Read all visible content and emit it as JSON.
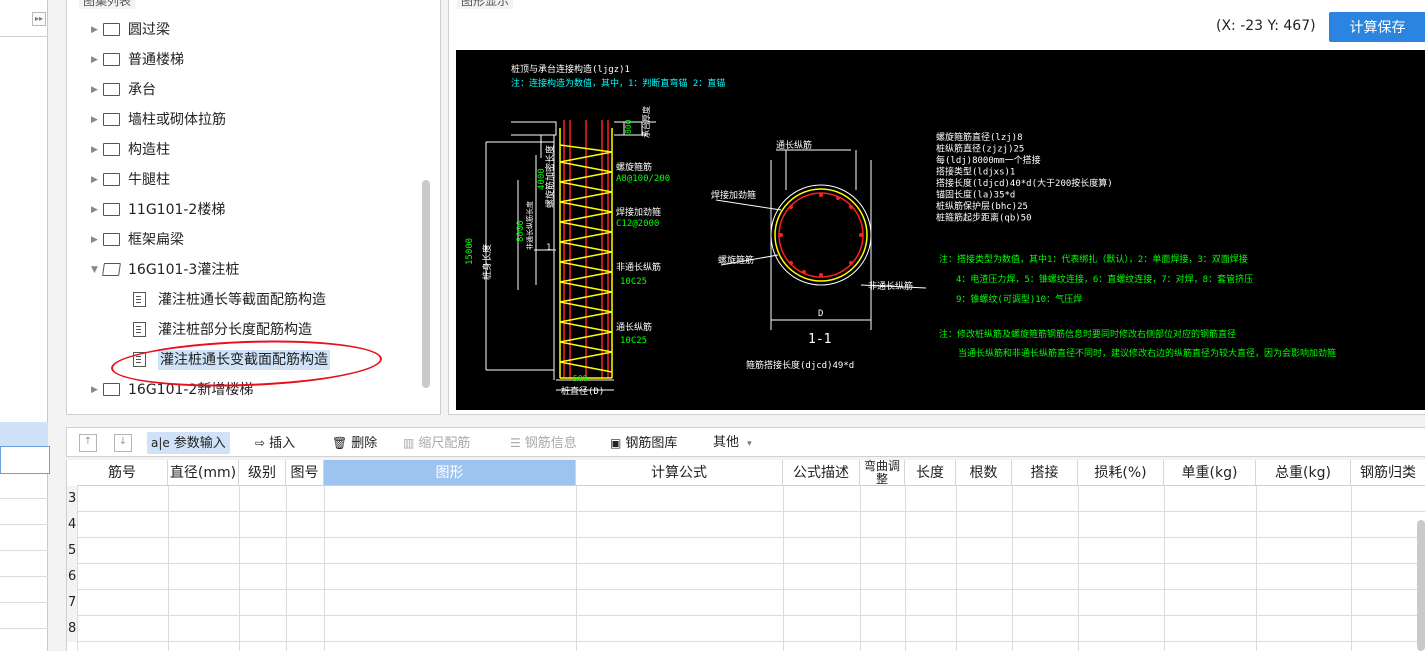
{
  "tree_panel": {
    "legend": "图集列表",
    "items": [
      {
        "label": "圆过梁",
        "level": 0,
        "type": "folder",
        "expanded": false
      },
      {
        "label": "普通楼梯",
        "level": 0,
        "type": "folder",
        "expanded": false
      },
      {
        "label": "承台",
        "level": 0,
        "type": "folder",
        "expanded": false
      },
      {
        "label": "墙柱或砌体拉筋",
        "level": 0,
        "type": "folder",
        "expanded": false
      },
      {
        "label": "构造柱",
        "level": 0,
        "type": "folder",
        "expanded": false
      },
      {
        "label": "牛腿柱",
        "level": 0,
        "type": "folder",
        "expanded": false
      },
      {
        "label": "11G101-2楼梯",
        "level": 0,
        "type": "folder",
        "expanded": false
      },
      {
        "label": "框架扁梁",
        "level": 0,
        "type": "folder",
        "expanded": false
      },
      {
        "label": "16G101-3灌注桩",
        "level": 0,
        "type": "folder",
        "expanded": true
      },
      {
        "label": "灌注桩通长等截面配筋构造",
        "level": 1,
        "type": "doc"
      },
      {
        "label": "灌注桩部分长度配筋构造",
        "level": 1,
        "type": "doc"
      },
      {
        "label": "灌注桩通长变截面配筋构造",
        "level": 1,
        "type": "doc",
        "selected": true
      },
      {
        "label": "16G101-2新增楼梯",
        "level": 0,
        "type": "folder",
        "expanded": false
      }
    ]
  },
  "graphic_panel": {
    "legend": "图形显示",
    "coords": "(X: -23 Y: 467)",
    "save_label": "计算保存",
    "drawing": {
      "title": "桩顶与承台连接构造(ljgz)1",
      "note_top": "注：连接构造为数值，其中，1：判断直弯锚      2：直锚",
      "dim_800": "800",
      "dim_15000": "15000",
      "dim_4000": "4000",
      "dim_8000": "8000",
      "dim_500": "500",
      "dim_D": "D",
      "dim_1": "1",
      "label_bearing": "承台厚度",
      "label_pile_length": "桩身长度",
      "label_spiral_length": "螺旋筋加密长度",
      "label_nonfull": "非通长纵筋长度",
      "label_spiral": "螺旋箍筋",
      "label_spiral_spec": "A8@100/200",
      "label_stiff": "焊接加劲箍",
      "label_stiff_spec": "C12@2000",
      "label_nonlong": "非通长纵筋",
      "label_nonlong_spec": "10C25",
      "label_long": "通长纵筋",
      "label_long_spec": "10C25",
      "label_diameter": "桩直径(D)",
      "section_long": "通长纵筋",
      "section_stiff": "焊接加劲箍",
      "section_spiral": "螺旋箍筋",
      "section_nonlong": "非通长纵筋",
      "section_title": "1-1",
      "section_lap": "箍筋搭接长度(djcd)49*d",
      "params": [
        "螺旋箍筋直径(lzj)8",
        "桩纵筋直径(zjzj)25",
        "每(ldj)8000mm一个搭接",
        "搭接类型(ldjxs)1",
        "搭接长度(ldjcd)40*d(大于200按长度算)",
        "锚固长度(la)35*d",
        "桩纵筋保护层(bhc)25",
        "桩箍筋起步距离(qb)50"
      ],
      "note_lap": [
        "注：搭接类型为数值，其中1：代表绑扎（默认），2：单面焊接，3：双面焊接",
        "4：电渣压力焊，5：锥螺纹连接，6：直螺纹连接，7：对焊，8：套管挤压",
        "9：锥螺纹(可调型)10：气压焊"
      ],
      "note_modify": [
        "注：修改桩纵筋及螺旋箍筋钢筋信息时要同时修改右侧部位对应的钢筋直径",
        "当通长纵筋和非通长纵筋直径不同时，建议修改右边的纵筋直径为较大直径，因为会影响加劲箍"
      ]
    }
  },
  "toolbar": {
    "up_icon": "↑",
    "down_icon": "↓",
    "param_input": "参数输入",
    "insert": "插入",
    "delete": "删除",
    "scale": "缩尺配筋",
    "rebar_info": "钢筋信息",
    "rebar_lib": "钢筋图库",
    "other": "其他"
  },
  "table": {
    "columns": [
      "筋号",
      "直径(mm)",
      "级别",
      "图号",
      "图形",
      "计算公式",
      "公式描述",
      "弯曲调整",
      "长度",
      "根数",
      "搭接",
      "损耗(%)",
      "单重(kg)",
      "总重(kg)",
      "钢筋归类"
    ],
    "row_numbers": [
      "3",
      "4",
      "5",
      "6",
      "7",
      "8"
    ]
  },
  "colors": {
    "accent": "#2b84e0",
    "selection": "#cfe2f7",
    "annotation": "#e8101c",
    "cad_yellow": "#ffff00",
    "cad_red": "#ff2020",
    "cad_green": "#00ff00",
    "cad_cyan": "#00ffff",
    "cad_white": "#ffffff"
  }
}
